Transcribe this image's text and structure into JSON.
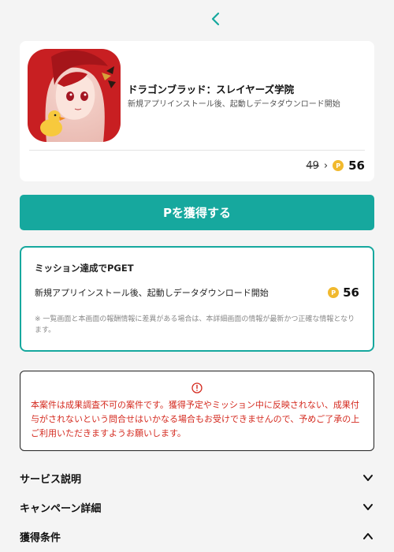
{
  "nav": {
    "back_icon": "chevron-left-icon"
  },
  "app": {
    "title": "ドラゴンブラッド：スレイヤーズ学院",
    "subtitle": "新規アプリインストール後、起動しデータダウンロード開始",
    "icon": "app-icon-image",
    "old_points": "49",
    "arrow": "›",
    "coin_glyph": "P",
    "new_points": "56"
  },
  "cta": {
    "label": "Pを獲得する"
  },
  "mission": {
    "title": "ミッション達成でPGET",
    "description": "新規アプリインストール後、起動しデータダウンロード開始",
    "points": "56",
    "coin_glyph": "P",
    "note": "※ 一覧画面と本画面の報酬情報に差異がある場合は、本詳細画面の情報が最新かつ正確な情報となります。"
  },
  "warning": {
    "icon": "info-icon",
    "text": "本案件は成果調査不可の案件です。獲得予定やミッション中に反映されない、成果付与がされないという問合せはいかなる場合もお受けできませんので、予めご了承の上ご利用いただきますようお願いします。"
  },
  "accordion": [
    {
      "label": "サービス説明",
      "state": "collapsed"
    },
    {
      "label": "キャンペーン詳細",
      "state": "collapsed"
    },
    {
      "label": "獲得条件",
      "state": "expanded"
    }
  ],
  "colors": {
    "accent": "#16a89e",
    "warning": "#d42a1f",
    "coin": "#f1b92e"
  }
}
